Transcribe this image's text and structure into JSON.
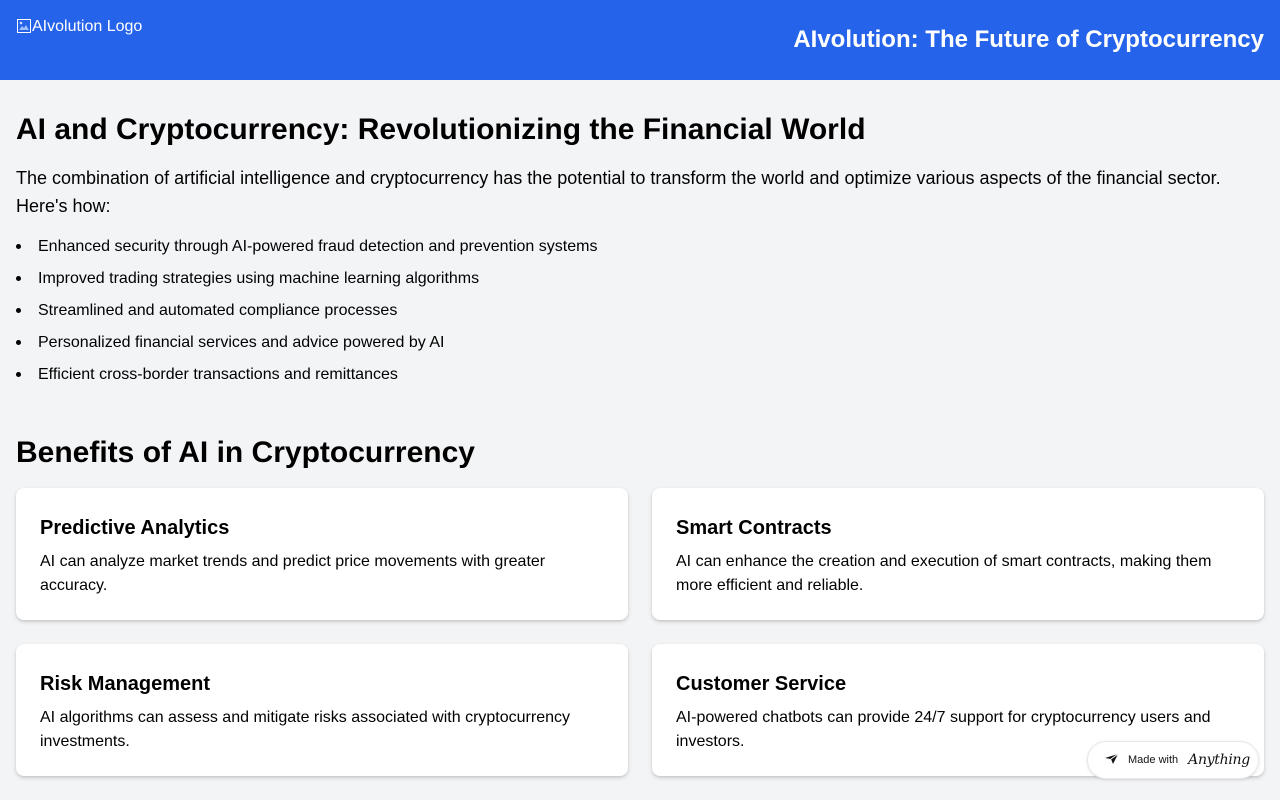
{
  "header": {
    "logo_alt": "AIvolution Logo",
    "site_title": "AIvolution: The Future of Cryptocurrency",
    "background_color": "#2563eb"
  },
  "intro": {
    "title": "AI and Cryptocurrency: Revolutionizing the Financial World",
    "text": "The combination of artificial intelligence and cryptocurrency has the potential to transform the world and optimize various aspects of the financial sector. Here's how:",
    "items": [
      "Enhanced security through AI-powered fraud detection and prevention systems",
      "Improved trading strategies using machine learning algorithms",
      "Streamlined and automated compliance processes",
      "Personalized financial services and advice powered by AI",
      "Efficient cross-border transactions and remittances"
    ]
  },
  "benefits": {
    "title": "Benefits of AI in Cryptocurrency",
    "cards": [
      {
        "title": "Predictive Analytics",
        "text": "AI can analyze market trends and predict price movements with greater accuracy."
      },
      {
        "title": "Smart Contracts",
        "text": "AI can enhance the creation and execution of smart contracts, making them more efficient and reliable."
      },
      {
        "title": "Risk Management",
        "text": "AI algorithms can assess and mitigate risks associated with cryptocurrency investments."
      },
      {
        "title": "Customer Service",
        "text": "AI-powered chatbots can provide 24/7 support for cryptocurrency users and investors."
      }
    ]
  },
  "badge": {
    "prefix": "Made with",
    "brand": "Anything",
    "icon": "anything-logo-icon"
  }
}
